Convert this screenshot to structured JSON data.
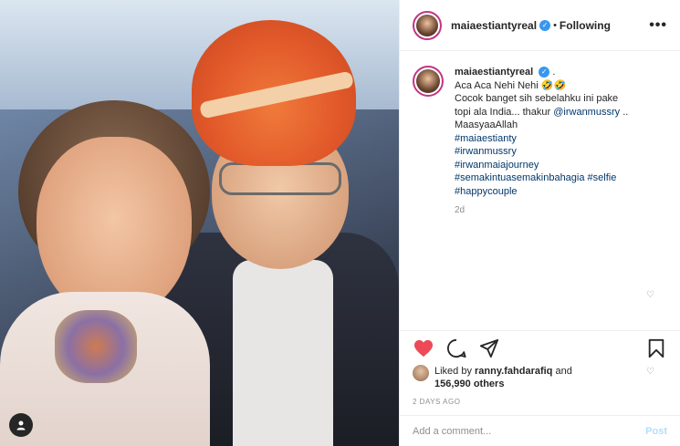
{
  "header": {
    "username": "maiaestiantyreal",
    "separator": "•",
    "follow_status": "Following",
    "more_label": "•••"
  },
  "caption": {
    "username": "maiaestiantyreal",
    "line1": ".",
    "line2": "Aca Aca Nehi Nehi 🤣🤣",
    "line3": "Cocok banget sih sebelahku ini pake",
    "line4a": "topi ala India... thakur ",
    "mention": "@irwanmussry",
    "line4b": " ..",
    "line5": "MaasyaaAllah",
    "hashtags": [
      "#maiaestianty",
      "#irwanmussry",
      "#irwanmaiajourney",
      "#semakintuasemakinbahagia",
      "#selfie",
      "#happycouple"
    ],
    "age": "2d"
  },
  "likes": {
    "prefix": "Liked by ",
    "user": "ranny.fahdarafiq",
    "and": " and",
    "count": "156,990 others"
  },
  "date": "2 DAYS AGO",
  "comment_box": {
    "placeholder": "Add a comment...",
    "post_label": "Post"
  },
  "icons": {
    "like": "heart-icon",
    "comment": "comment-icon",
    "share": "share-icon",
    "save": "bookmark-icon",
    "tag": "user-tag-icon"
  },
  "colors": {
    "liked_heart": "#ed4956",
    "link": "#00376b",
    "verified": "#3897f0",
    "post_disabled": "#b2dffc"
  }
}
